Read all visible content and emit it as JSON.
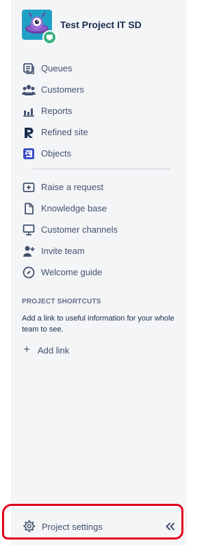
{
  "project": {
    "title": "Test Project IT SD"
  },
  "nav_primary": [
    {
      "label": "Queues",
      "icon": "queues-icon"
    },
    {
      "label": "Customers",
      "icon": "customers-icon"
    },
    {
      "label": "Reports",
      "icon": "reports-icon"
    },
    {
      "label": "Refined site",
      "icon": "refined-logo-icon"
    },
    {
      "label": "Objects",
      "icon": "objects-icon"
    }
  ],
  "nav_secondary": [
    {
      "label": "Raise a request",
      "icon": "raise-request-icon"
    },
    {
      "label": "Knowledge base",
      "icon": "document-icon"
    },
    {
      "label": "Customer channels",
      "icon": "monitor-icon"
    },
    {
      "label": "Invite team",
      "icon": "invite-user-icon"
    },
    {
      "label": "Welcome guide",
      "icon": "compass-icon"
    }
  ],
  "shortcuts": {
    "heading": "PROJECT SHORTCUTS",
    "description": "Add a link to useful information for your whole team to see.",
    "add_link_label": "Add link"
  },
  "footer": {
    "settings_label": "Project settings",
    "collapse_glyph": "«"
  },
  "colors": {
    "sidebar_bg": "#f4f5f7",
    "text": "#42526e",
    "title": "#172b4d",
    "objects_brand": "#3d4fc4",
    "avatar_bg": "#1fa1c5",
    "badge": "#36b37e",
    "annotation": "#e0001b"
  }
}
